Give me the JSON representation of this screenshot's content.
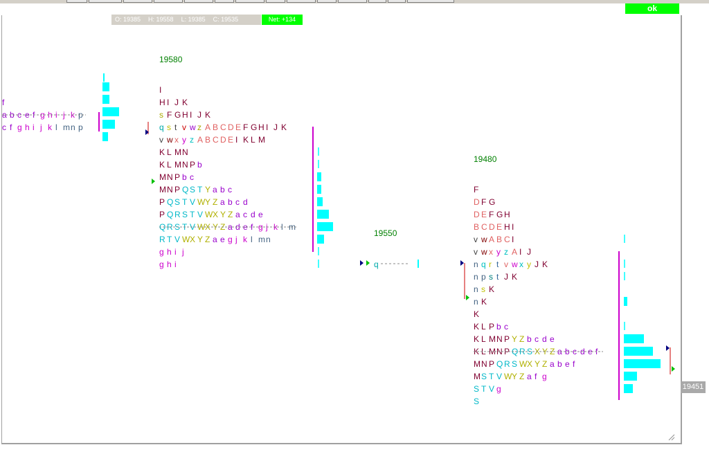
{
  "ok_button": "ok",
  "ohlc": {
    "open": "O: 19385",
    "high": "H: 19558",
    "low": "L: 19385",
    "close": "C: 19535",
    "net": "Net: +134"
  },
  "price_axis_label": "19451",
  "colors": {
    "bar": "#00ffff",
    "value_area": "#cc00cc",
    "ok": "#00ff00",
    "initial_balance": "#cc0000"
  },
  "chart_data": {
    "type": "market-profile (TPO)",
    "profiles": [
      {
        "label": "",
        "rows": [
          {
            "tpo": "f",
            "bar": 0.0
          },
          {
            "tpo": "a b c e f g h i j k p",
            "bar": 1.0,
            "poc": true
          },
          {
            "tpo": "c f g h i j k l m n p",
            "bar": 0.7
          }
        ],
        "extra_bars": [
          0.05,
          0.35,
          0.4,
          0.3
        ]
      },
      {
        "label": "19580",
        "rows": [
          {
            "tpo": "I",
            "bar": 0.0
          },
          {
            "tpo": "H I J K",
            "bar": 0.0
          },
          {
            "tpo": "s F G H I J K",
            "bar": 0.0
          },
          {
            "tpo": "q s t v w z A B C D E F G H I J K",
            "bar": 0.0
          },
          {
            "tpo": "v w x y z A B C D E I K L M",
            "bar": 0.0
          },
          {
            "tpo": "K L M N",
            "bar": 0.05
          },
          {
            "tpo": "K L M N P b",
            "bar": 0.05
          },
          {
            "tpo": "M N P b c",
            "bar": 0.25
          },
          {
            "tpo": "M N P Q S T Y a b c",
            "bar": 0.25
          },
          {
            "tpo": "P Q S T V W Y Z a b c d",
            "bar": 0.33
          },
          {
            "tpo": "P Q R S T V W X Y Z a c d e",
            "bar": 0.75
          },
          {
            "tpo": "Q R S T V W X Y Z a d e f g j k l m",
            "bar": 1.0,
            "poc": true
          },
          {
            "tpo": "R T V W X Y Z a e g j k l m n",
            "bar": 0.45
          },
          {
            "tpo": "g h i j",
            "bar": 0.05
          },
          {
            "tpo": "g h i",
            "bar": 0.05
          }
        ]
      },
      {
        "label": "19550",
        "rows": [
          {
            "tpo": "q",
            "bar": 0.1
          }
        ]
      },
      {
        "label": "19480",
        "rows": [
          {
            "tpo": "F",
            "bar": 0.0
          },
          {
            "tpo": "D F G",
            "bar": 0.0
          },
          {
            "tpo": "D E F G H",
            "bar": 0.0
          },
          {
            "tpo": "B C D E H I",
            "bar": 0.0
          },
          {
            "tpo": "v w A B C I",
            "bar": 0.03
          },
          {
            "tpo": "v w x y z A I J",
            "bar": 0.0
          },
          {
            "tpo": "n q r t v w x y J K",
            "bar": 0.03
          },
          {
            "tpo": "n p s t J K",
            "bar": 0.03
          },
          {
            "tpo": "n s K",
            "bar": 0.0
          },
          {
            "tpo": "n K",
            "bar": 0.1
          },
          {
            "tpo": "K",
            "bar": 0.0
          },
          {
            "tpo": "K L P b c",
            "bar": 0.03
          },
          {
            "tpo": "K L M N P Y Z b c d e",
            "bar": 0.55
          },
          {
            "tpo": "K L M N P Q R S X Y Z a b c d e f",
            "bar": 0.8,
            "poc": true
          },
          {
            "tpo": "M N P Q R S W X Y Z a b e f",
            "bar": 1.0
          },
          {
            "tpo": "M S T V W Y Z a f g",
            "bar": 0.35
          },
          {
            "tpo": "S T V g",
            "bar": 0.25
          },
          {
            "tpo": "S",
            "bar": 0.0
          }
        ]
      }
    ]
  }
}
